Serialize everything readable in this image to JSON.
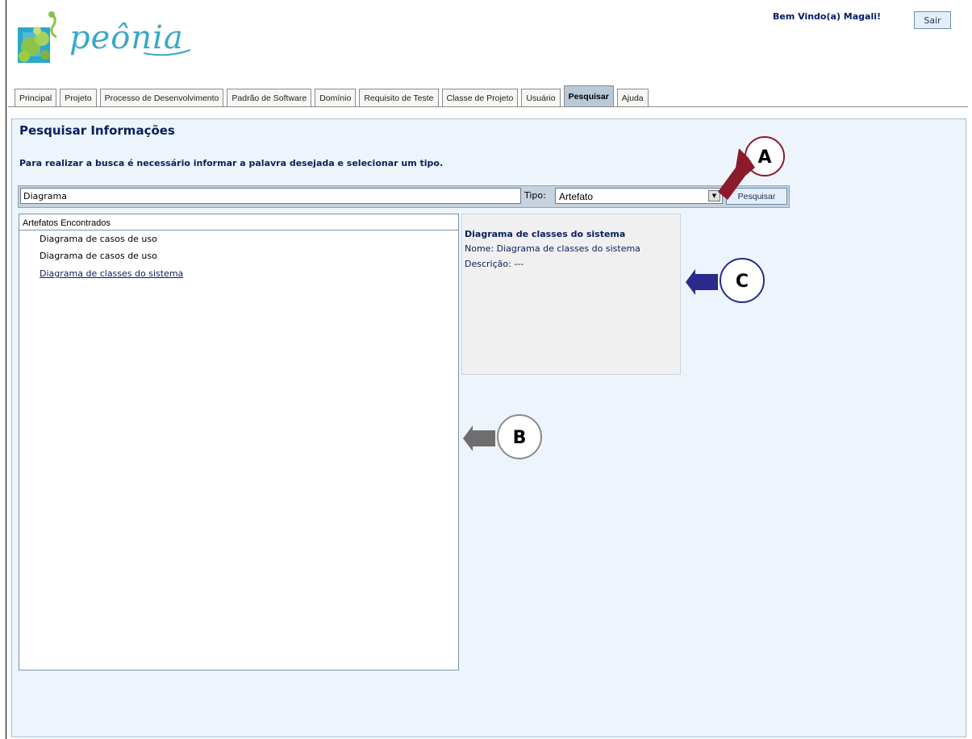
{
  "app": {
    "logo_text": "peônia",
    "welcome": "Bem Vindo(a) Magali!",
    "logout_label": "Sair"
  },
  "tabs": [
    {
      "label": "Principal",
      "active": false
    },
    {
      "label": "Projeto",
      "active": false
    },
    {
      "label": "Processo de Desenvolvimento",
      "active": false
    },
    {
      "label": "Padrão de Software",
      "active": false
    },
    {
      "label": "Domínio",
      "active": false
    },
    {
      "label": "Requisito de Teste",
      "active": false
    },
    {
      "label": "Classe de Projeto",
      "active": false
    },
    {
      "label": "Usuário",
      "active": false
    },
    {
      "label": "Pesquisar",
      "active": true
    },
    {
      "label": "Ajuda",
      "active": false
    }
  ],
  "search": {
    "title": "Pesquisar Informações",
    "instructions": "Para realizar a busca é necessário informar a palavra desejada e selecionar um tipo.",
    "query": "Diagrama",
    "tipo_label": "Tipo:",
    "tipo_value": "Artefato",
    "button_label": "Pesquisar"
  },
  "results": {
    "header": "Artefatos Encontrados",
    "items": [
      "Diagrama de casos de uso",
      "Diagrama de casos de uso",
      "Diagrama de classes do sistema"
    ]
  },
  "detail": {
    "title": "Diagrama de classes do sistema",
    "name_line": "Nome: Diagrama de classes do sistema",
    "desc_line": "Descrição: ---"
  },
  "annotations": {
    "a": "A",
    "b": "B",
    "c": "C"
  },
  "colors": {
    "arrow_a": "#8b1a2a",
    "arrow_b": "#6e6e6e",
    "arrow_c": "#2a2a8c",
    "panel_bg": "#edf4fb",
    "active_tab": "#b9c9d9"
  }
}
